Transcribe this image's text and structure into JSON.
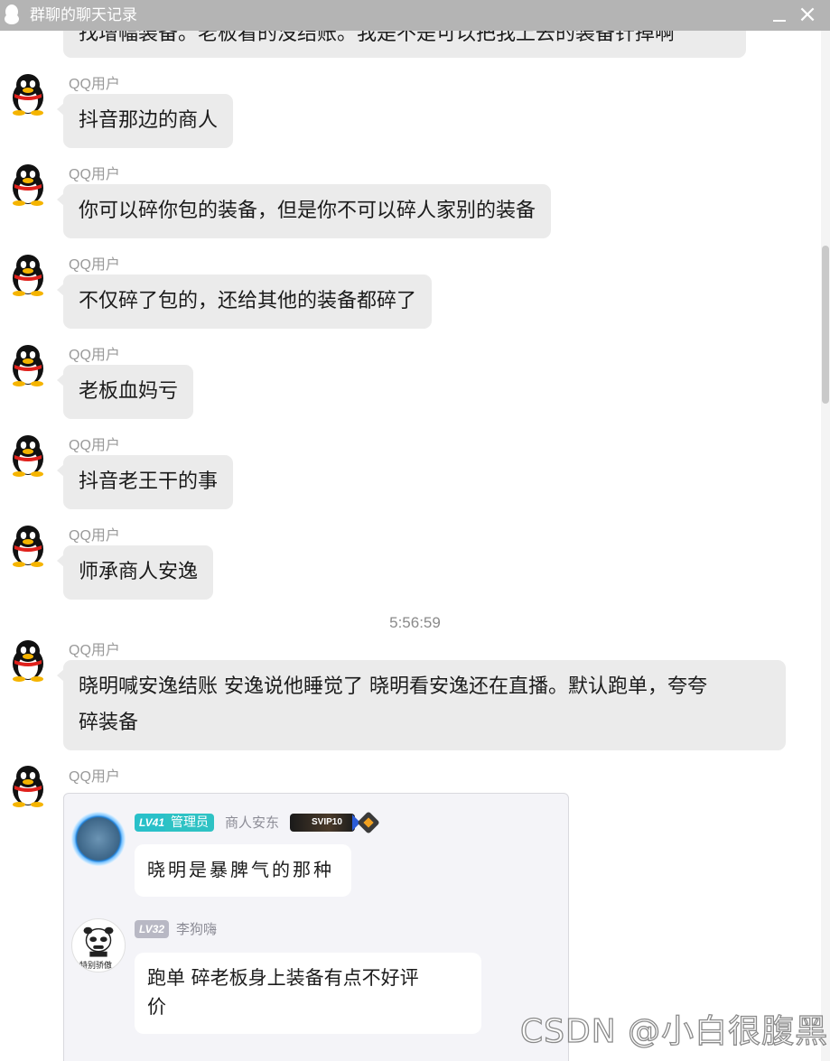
{
  "window": {
    "title": "群聊的聊天记录",
    "minimize_label": "",
    "close_label": "×"
  },
  "colors": {
    "titlebar": "#b4b4b4",
    "bubble": "#ebebeb",
    "admin_tag": "#2ec2c4"
  },
  "messages": [
    {
      "sender": "QQ用户",
      "text": "抖音那边的商人"
    },
    {
      "sender": "QQ用户",
      "text": "你可以碎你包的装备，但是你不可以碎人家别的装备"
    },
    {
      "sender": "QQ用户",
      "text": "不仅碎了包的，还给其他的装备都碎了"
    },
    {
      "sender": "QQ用户",
      "text": "老板血妈亏"
    },
    {
      "sender": "QQ用户",
      "text": "抖音老王干的事"
    },
    {
      "sender": "QQ用户",
      "text": "师承商人安逸"
    },
    {
      "sender": "QQ用户",
      "text_line1": "晓明喊安逸结账 安逸说他睡觉了  晓明看安逸还在直播。默认跑单，夸夸",
      "text_line2": "碎装备"
    },
    {
      "sender": "QQ用户"
    }
  ],
  "cut_message_text": "找增幅装备。老板看的没结账。我是不是可以把我上去的装备针掉啊",
  "timestamp": "5:56:59",
  "screenshot_image": {
    "msg1": {
      "level": "LV41",
      "role": "管理员",
      "name": "商人安东",
      "vip": "SVIP10",
      "text": "晓明是暴脾气的那种"
    },
    "msg2": {
      "level": "LV32",
      "name": "李狗嗨",
      "avatar_caption": "特别骄傲",
      "text_line1": "跑单  碎老板身上装备有点不好评",
      "text_line2": "价"
    }
  },
  "watermark": "CSDN @小白很腹黑"
}
